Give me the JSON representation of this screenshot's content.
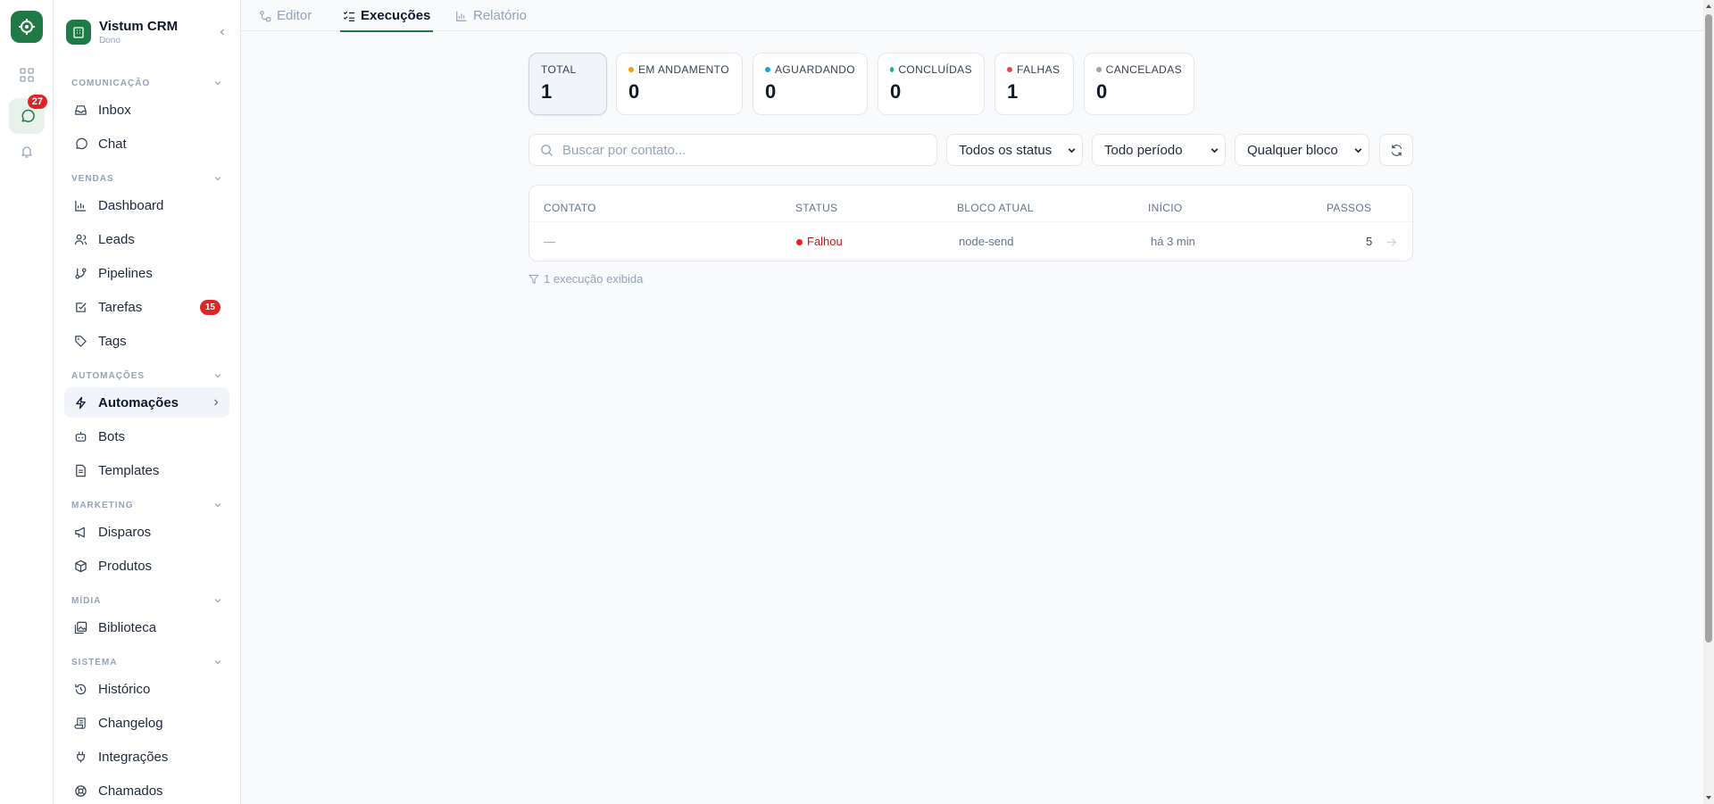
{
  "app": {
    "name": "Vistum CRM",
    "role": "Dono"
  },
  "rail": {
    "chat_badge": "27"
  },
  "sidebar": {
    "sections": {
      "comunicacao": "COMUNICAÇÃO",
      "vendas": "VENDAS",
      "automacoes": "AUTOMAÇÕES",
      "marketing": "MARKETING",
      "midia": "MÍDIA",
      "sistema": "SISTEMA"
    },
    "items": {
      "inbox": "Inbox",
      "chat": "Chat",
      "dashboard": "Dashboard",
      "leads": "Leads",
      "pipelines": "Pipelines",
      "tarefas": "Tarefas",
      "tarefas_badge": "15",
      "tags": "Tags",
      "automacoes": "Automações",
      "bots": "Bots",
      "templates": "Templates",
      "disparos": "Disparos",
      "produtos": "Produtos",
      "biblioteca": "Biblioteca",
      "historico": "Histórico",
      "changelog": "Changelog",
      "integracoes": "Integrações",
      "chamados": "Chamados"
    }
  },
  "tabs": {
    "editor": "Editor",
    "execucoes": "Execuções",
    "relatorio": "Relatório"
  },
  "stats": {
    "total": {
      "label": "TOTAL",
      "value": "1"
    },
    "andamento": {
      "label": "EM ANDAMENTO",
      "value": "0",
      "color": "#f59e0b"
    },
    "aguardando": {
      "label": "AGUARDANDO",
      "value": "0",
      "color": "#0ea5e9"
    },
    "concluidas": {
      "label": "CONCLUÍDAS",
      "value": "0",
      "color": "#10b981"
    },
    "falhas": {
      "label": "FALHAS",
      "value": "1",
      "color": "#ef4444"
    },
    "canceladas": {
      "label": "CANCELADAS",
      "value": "0",
      "color": "#9ca3af"
    }
  },
  "filters": {
    "search_placeholder": "Buscar por contato...",
    "status": "Todos os status",
    "period": "Todo período",
    "block": "Qualquer bloco"
  },
  "table": {
    "headers": {
      "contato": "CONTATO",
      "status": "STATUS",
      "bloco": "BLOCO ATUAL",
      "inicio": "INÍCIO",
      "passos": "PASSOS"
    },
    "rows": [
      {
        "contato": "—",
        "status": "Falhou",
        "bloco": "node-send",
        "inicio": "há 3 min",
        "passos": "5"
      }
    ],
    "footer": "1 execução exibida"
  },
  "accent_color": "#1f7a45"
}
